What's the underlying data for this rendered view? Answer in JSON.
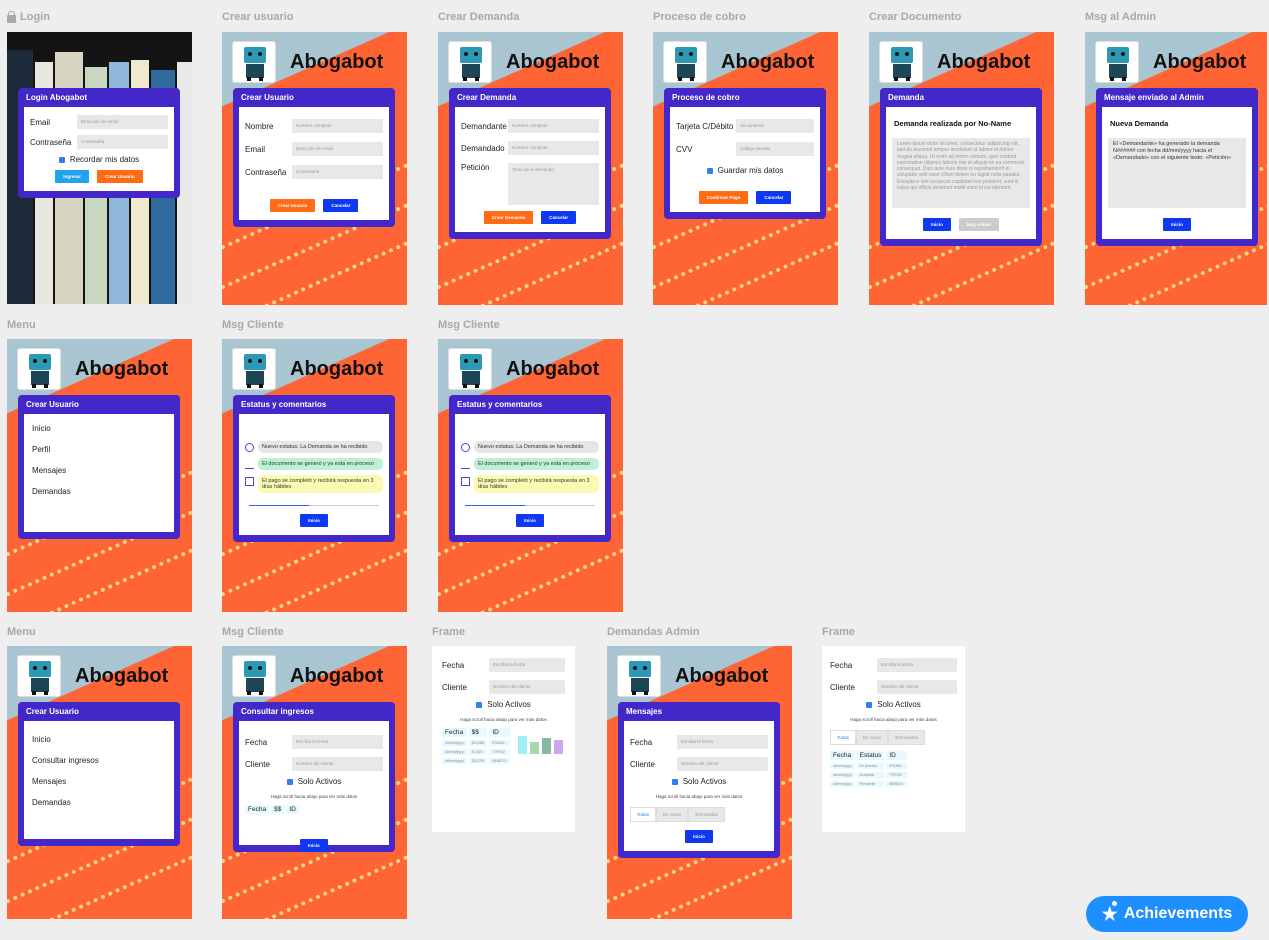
{
  "brand": "Abogabot",
  "labels": {
    "login": "Login",
    "crear_usuario": "Crear usuario",
    "crear_demanda": "Crear Demanda",
    "proceso_cobro": "Proceso de cobro",
    "crear_documento": "Crear Documento",
    "msg_admin": "Msg al Admin",
    "menu1": "Menu",
    "msg_cliente1": "Msg Cliente",
    "msg_cliente2": "Msg Cliente",
    "menu2": "Menu",
    "msg_cliente3": "Msg Cliente",
    "frame1": "Frame",
    "demandas_admin": "Demandas Admin",
    "frame2": "Frame"
  },
  "login": {
    "title": "Login Abogabot",
    "email": "Email",
    "email_ph": "Dirección de email",
    "pass": "Contraseña",
    "pass_ph": "Contraseña",
    "remember": "Recordar mis datos",
    "ingresar": "Ingresar",
    "crear": "Crear Usuario",
    "spines": [
      "NEW DIGITAL AGE",
      "Public Relations",
      "Peter Thiel",
      "THE",
      "TRUST ME I'M LYING"
    ]
  },
  "crear_usuario": {
    "title": "Crear Usuario",
    "nombre": "Nombre",
    "nombre_ph": "Nombre completo",
    "email": "Email",
    "email_ph": "Dirección de email",
    "pass": "Contraseña",
    "pass_ph": "Contraseña",
    "crear": "Crear Usuario",
    "cancelar": "Cancelar"
  },
  "crear_demanda": {
    "title": "Crear Demanda",
    "demandante": "Demandante",
    "demandante_ph": "Nombre completo",
    "demandado": "Demandado",
    "demandado_ph": "Nombre completo",
    "peticion": "Petición",
    "peticion_ph": "Texto de la demanda",
    "crear": "Crear Demanda",
    "cancelar": "Cancelar"
  },
  "cobro": {
    "title": "Proceso de cobro",
    "tarjeta": "Tarjeta C/Débito",
    "tarjeta_ph": "16 números",
    "cvv": "CVV",
    "cvv_ph": "Código secreto",
    "guardar": "Guardar mis datos",
    "confirmar": "Confirmar Pago",
    "cancelar": "Cancelar"
  },
  "documento": {
    "title": "Demanda",
    "heading": "Demanda realizada por No-Name",
    "lorem": "Lorem ipsum dolor sit amet, consectetur adipiscing elit, sed do eiusmod tempor incididunt ut labore et dolore magna aliqua. Ut enim ad minim veniam, quis nostrud exercitation ullamco laboris nisi ut aliquip ex ea commodo consequat. Duis aute irure dolor in reprehenderit in voluptate velit esse cillum dolore eu fugiat nulla pariatur. Excepteur sint occaecat cupidatat non proident, sunt in culpa qui officia deserunt mollit anim id est laborum.",
    "inicio": "Inicio",
    "msg_admin": "Msg Admin"
  },
  "admin": {
    "title": "Mensaje enviado al Admin",
    "heading": "Nueva Demanda",
    "text": "El «Demandante» ha generado la demanda N###### con fecha dd/mm/yyyy hacia el «Demandado» con el siguiente texto: «Petición»",
    "inicio": "Inicio"
  },
  "menu1": {
    "title": "Crear Usuario",
    "items": [
      "Inicio",
      "Perfil",
      "Mensajes",
      "Demandas"
    ]
  },
  "estatus": {
    "title": "Estatus y comentarios",
    "items": [
      "Nuevo estatus. La Demanda se ha recibido",
      "El documento se generó y ya esta en proceso",
      "El pago se completó y recibirá respuesta en 3 días hábiles"
    ],
    "inicio": "Inicio"
  },
  "menu2": {
    "title": "Crear Usuario",
    "items": [
      "Inicio",
      "Consultar ingresos",
      "Mensajes",
      "Demandas"
    ]
  },
  "ingresos": {
    "title": "Consultar ingresos",
    "fecha": "Fecha",
    "fecha_ph": "Escriba la fecha",
    "cliente": "Cliente",
    "cliente_ph": "Nombre del cliente",
    "activos": "Solo Activos",
    "scroll": "Haga scroll hacia abajo para ver más datos",
    "cols": [
      "Fecha",
      "$$",
      "ID"
    ],
    "inicio": "Inicio"
  },
  "frame1": {
    "fecha": "Fecha",
    "fecha_ph": "Escriba la fecha",
    "cliente": "Cliente",
    "cliente_ph": "Nombre del cliente",
    "activos": "Solo Activos",
    "scroll": "Haga scroll hacia abajo para ver más datos",
    "cols": [
      "Fecha",
      "$$",
      "ID"
    ],
    "rows": [
      [
        "dd/mm/yyyy",
        "$15,586",
        "8703A9"
      ],
      [
        "dd/mm/yyyy",
        "$7,823",
        "77FEE2"
      ],
      [
        "dd/mm/yyyy",
        "$15,799",
        "8698D70"
      ]
    ],
    "bars": [
      {
        "h": 18,
        "color": "#9ef0f5"
      },
      {
        "h": 12,
        "color": "#a8d7a8"
      },
      {
        "h": 16,
        "color": "#88b8a8"
      },
      {
        "h": 14,
        "color": "#c8a8f0"
      }
    ]
  },
  "mensajes": {
    "title": "Mensajes",
    "fecha": "Fecha",
    "fecha_ph": "Escriba la fecha",
    "cliente": "Cliente",
    "cliente_ph": "Nombre del cliente",
    "activos": "Solo Activos",
    "scroll": "Haga scroll hacia abajo para ver más datos",
    "tabs": [
      "Todas",
      "En curso",
      "Terminadas"
    ],
    "inicio": "Inicio"
  },
  "frame2": {
    "fecha": "Fecha",
    "fecha_ph": "Escriba la fecha",
    "cliente": "Cliente",
    "cliente_ph": "Nombre del cliente",
    "activos": "Solo Activos",
    "scroll": "Haga scroll hacia abajo para ver más datos",
    "tabs": [
      "Todas",
      "En curso",
      "Terminadas"
    ],
    "cols": [
      "Fecha",
      "Estatus",
      "ID"
    ],
    "rows": [
      [
        "dd/mm/yyyy",
        "En proceso",
        "8703A9"
      ],
      [
        "dd/mm/yyyy",
        "Aceptado",
        "77FEE2"
      ],
      [
        "dd/mm/yyyy",
        "Pendiente",
        "8698D70"
      ]
    ]
  },
  "achievements": "Achievements"
}
